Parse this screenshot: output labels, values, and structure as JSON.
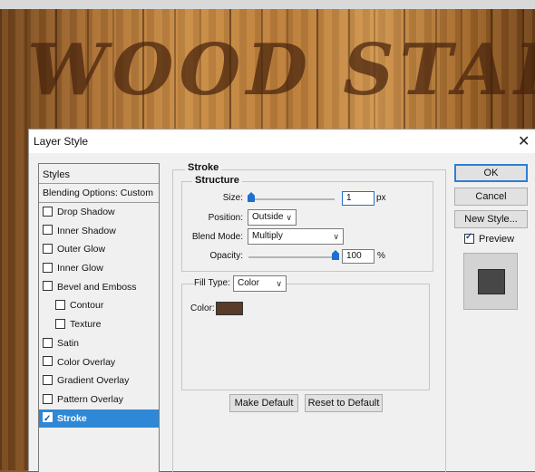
{
  "canvas": {
    "text": "WOOD STAIN"
  },
  "dialog": {
    "title": "Layer Style",
    "close_glyph": "✕",
    "styles_header": "Styles",
    "blending_options": "Blending Options: Custom",
    "effects": [
      {
        "label": "Drop Shadow",
        "checked": false
      },
      {
        "label": "Inner Shadow",
        "checked": false
      },
      {
        "label": "Outer Glow",
        "checked": false
      },
      {
        "label": "Inner Glow",
        "checked": false
      },
      {
        "label": "Bevel and Emboss",
        "checked": false
      },
      {
        "label": "Contour",
        "checked": false
      },
      {
        "label": "Texture",
        "checked": false
      },
      {
        "label": "Satin",
        "checked": false
      },
      {
        "label": "Color Overlay",
        "checked": false
      },
      {
        "label": "Gradient Overlay",
        "checked": false
      },
      {
        "label": "Pattern Overlay",
        "checked": false
      },
      {
        "label": "Stroke",
        "checked": true,
        "selected": true
      }
    ]
  },
  "stroke": {
    "group_title": "Stroke",
    "structure": {
      "title": "Structure",
      "size_label": "Size:",
      "size_value": "1",
      "size_unit": "px",
      "position_label": "Position:",
      "position_value": "Outside",
      "blend_label": "Blend Mode:",
      "blend_value": "Multiply",
      "opacity_label": "Opacity:",
      "opacity_value": "100",
      "opacity_unit": "%"
    },
    "fill": {
      "type_label": "Fill Type:",
      "type_value": "Color",
      "color_label": "Color:",
      "color_hex": "#5a3a28"
    },
    "make_default": "Make Default",
    "reset_default": "Reset to Default"
  },
  "buttons": {
    "ok": "OK",
    "cancel": "Cancel",
    "new_style": "New Style...",
    "preview_label": "Preview",
    "preview_checked": true
  },
  "colors": {
    "accent": "#2f88d6",
    "slider_thumb": "#1f6fd0"
  }
}
